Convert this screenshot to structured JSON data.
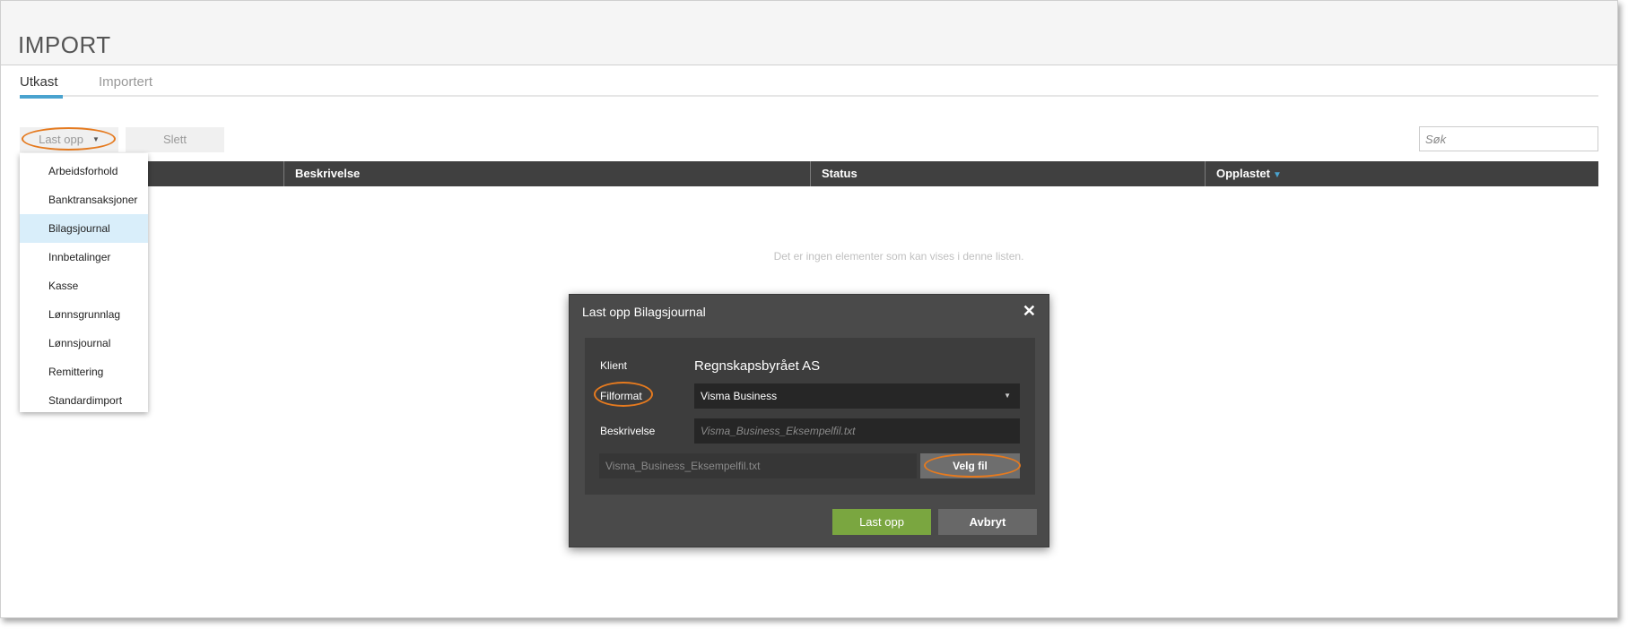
{
  "page": {
    "title": "IMPORT"
  },
  "tabs": [
    {
      "label": "Utkast"
    },
    {
      "label": "Importert"
    }
  ],
  "toolbar": {
    "upload_label": "Last opp",
    "delete_label": "Slett"
  },
  "search": {
    "placeholder": "Søk"
  },
  "table": {
    "columns": [
      "",
      "Beskrivelse",
      "Status",
      "Opplastet"
    ],
    "empty_message": "Det er ingen elementer som kan vises i denne listen."
  },
  "upload_menu": {
    "items": [
      {
        "label": "Arbeidsforhold"
      },
      {
        "label": "Banktransaksjoner"
      },
      {
        "label": "Bilagsjournal"
      },
      {
        "label": "Innbetalinger"
      },
      {
        "label": "Kasse"
      },
      {
        "label": "Lønnsgrunnlag"
      },
      {
        "label": "Lønnsjournal"
      },
      {
        "label": "Remittering"
      },
      {
        "label": "Standardimport"
      }
    ],
    "selected": "Bilagsjournal"
  },
  "modal": {
    "title": "Last opp Bilagsjournal",
    "client_label": "Klient",
    "client_value": "Regnskapsbyrået AS",
    "format_label": "Filformat",
    "format_value": "Visma Business",
    "description_label": "Beskrivelse",
    "description_placeholder": "Visma_Business_Eksempelfil.txt",
    "file_name": "Visma_Business_Eksempelfil.txt",
    "choose_file_label": "Velg fil",
    "submit_label": "Last opp",
    "cancel_label": "Avbryt"
  },
  "colors": {
    "accent": "#4aa3cf",
    "highlight_ring": "#e57a1f",
    "primary_button": "#7aa640",
    "table_header": "#404040",
    "modal_bg": "#4a4a4a",
    "menu_selected": "#d9eefa"
  },
  "icons": {
    "dropdown_caret": "caret-down-icon",
    "sort_indicator": "sort-down-icon",
    "close": "close-icon"
  }
}
